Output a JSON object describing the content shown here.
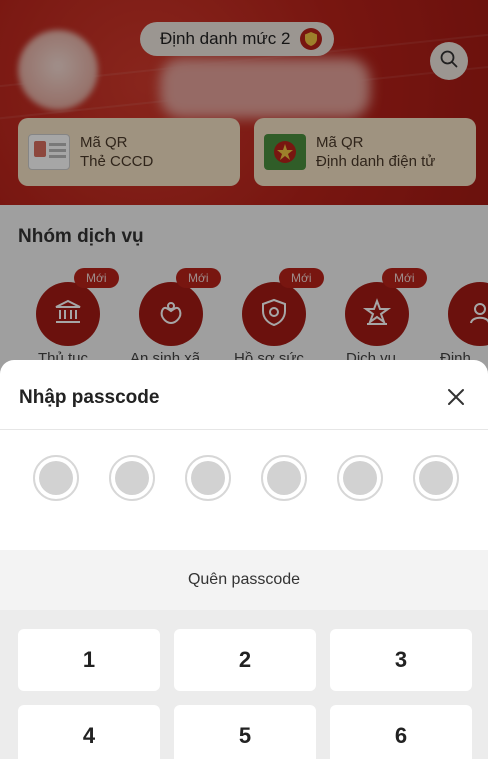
{
  "header": {
    "level_label": "Định danh mức 2",
    "search_icon": "search-icon",
    "shield_icon": "shield-icon"
  },
  "qr_cards": [
    {
      "title": "Mã QR",
      "subtitle": "Thẻ CCCD",
      "icon": "id-card-icon"
    },
    {
      "title": "Mã QR",
      "subtitle": "Định danh điện tử",
      "icon": "police-emblem-icon"
    }
  ],
  "services": {
    "title": "Nhóm dịch vụ",
    "items": [
      {
        "badge": "Mới",
        "label": "Thủ tục",
        "icon": "government-building-icon"
      },
      {
        "badge": "Mới",
        "label": "An sinh xã",
        "icon": "social-welfare-icon"
      },
      {
        "badge": "Mới",
        "label": "Hồ sơ sức",
        "icon": "health-record-icon"
      },
      {
        "badge": "Mới",
        "label": "Dịch vụ",
        "icon": "star-service-icon"
      },
      {
        "badge": "",
        "label": "Định",
        "icon": "identity-icon"
      }
    ]
  },
  "passcode_sheet": {
    "title": "Nhập passcode",
    "close_icon": "close-icon",
    "digits_count": 6,
    "forgot_label": "Quên passcode",
    "keys": [
      "1",
      "2",
      "3",
      "4",
      "5",
      "6"
    ]
  },
  "colors": {
    "brand_red": "#b8221a",
    "card_beige": "#f5e2c5"
  }
}
